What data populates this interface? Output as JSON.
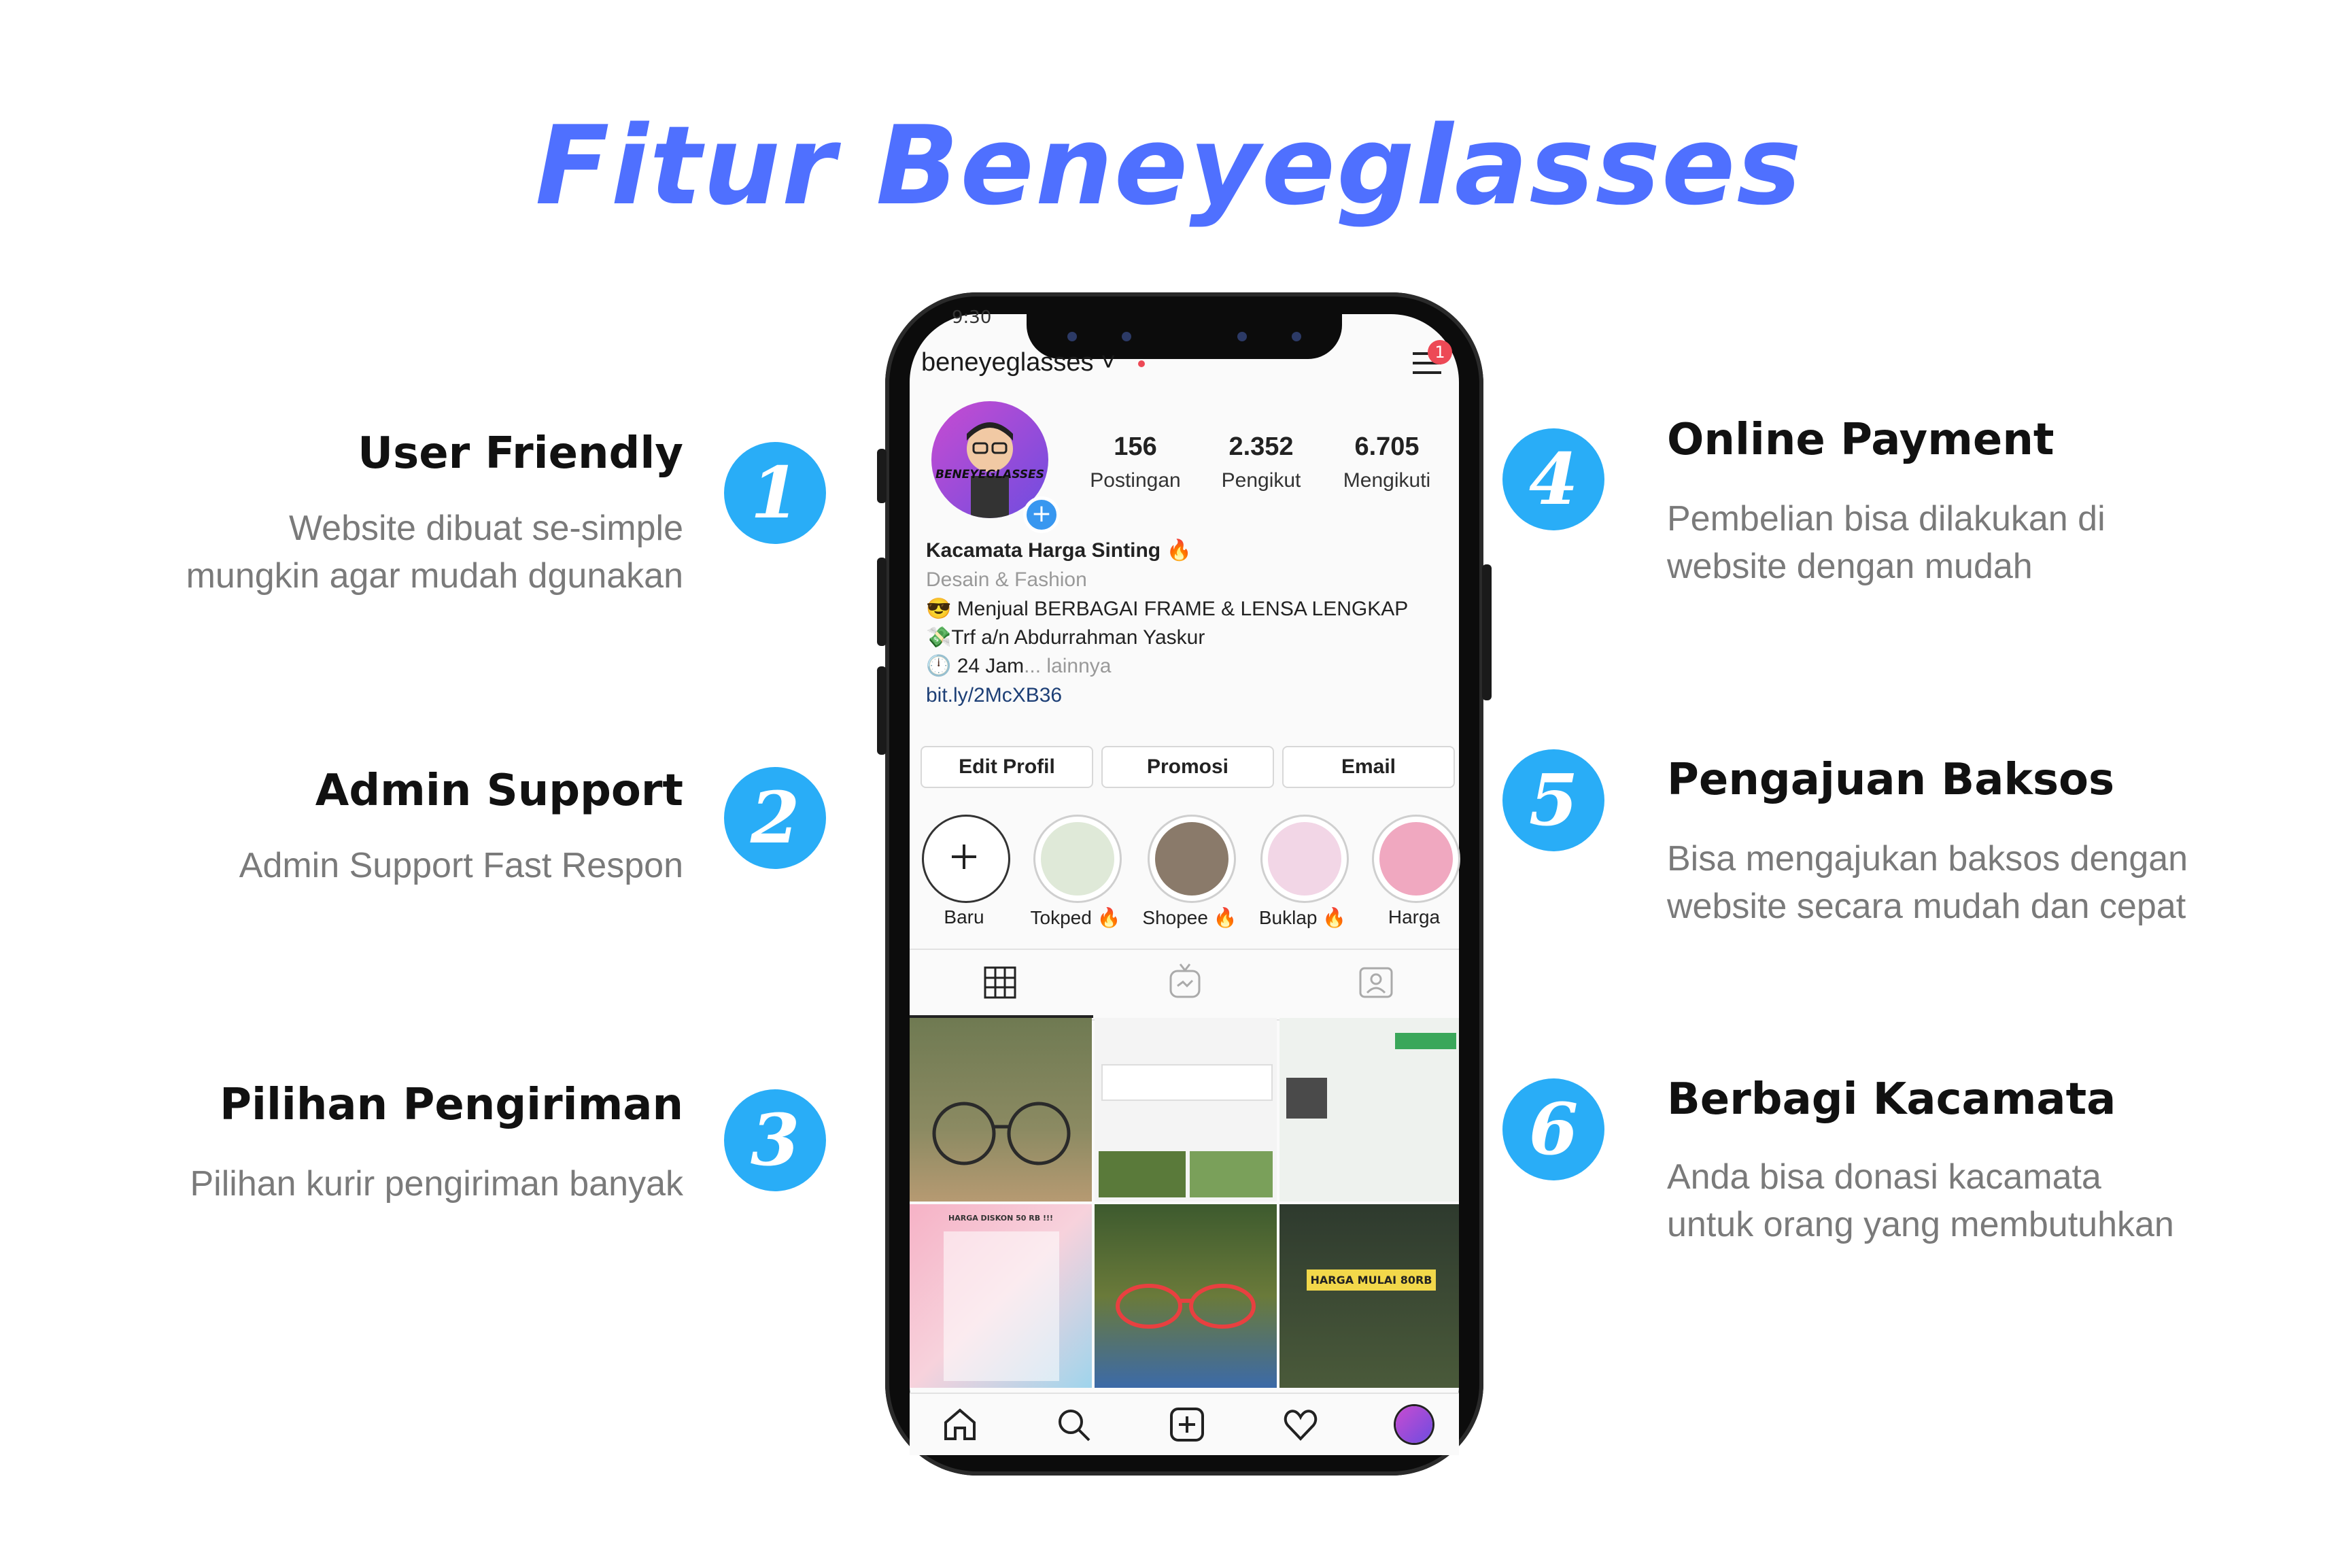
{
  "title": "Fitur Beneyeglasses",
  "features_left": [
    {
      "number": "1",
      "title": "User Friendly",
      "desc_line1": "Website dibuat se-simple",
      "desc_line2": "mungkin agar mudah dgunakan"
    },
    {
      "number": "2",
      "title": "Admin Support",
      "desc_line1": "Admin Support Fast Respon"
    },
    {
      "number": "3",
      "title": "Pilihan Pengiriman",
      "desc_line1": "Pilihan kurir pengiriman banyak"
    }
  ],
  "features_right": [
    {
      "number": "4",
      "title": "Online Payment",
      "desc_line1": "Pembelian bisa dilakukan di",
      "desc_line2": "website dengan mudah"
    },
    {
      "number": "5",
      "title": "Pengajuan Baksos",
      "desc_line1": "Bisa mengajukan baksos dengan",
      "desc_line2": "website secara mudah dan cepat"
    },
    {
      "number": "6",
      "title": "Berbagi Kacamata",
      "desc_line1": "Anda bisa donasi kacamata",
      "desc_line2": "untuk orang yang membutuhkan"
    }
  ],
  "phone": {
    "username": "beneyeglasses ˅",
    "notification_count": "1",
    "avatar_text": "BENEYEGLASSES",
    "stats": [
      {
        "value": "156",
        "label": "Postingan"
      },
      {
        "value": "2.352",
        "label": "Pengikut"
      },
      {
        "value": "6.705",
        "label": "Mengikuti"
      }
    ],
    "bio": {
      "name": "Kacamata Harga Sinting 🔥",
      "category": "Desain & Fashion",
      "line1": "😎 Menjual BERBAGAI FRAME & LENSA LENGKAP",
      "line2": "💸Trf a/n Abdurrahman Yaskur",
      "line3_main": "🕛 24 Jam",
      "line3_more": "... lainnya",
      "link": "bit.ly/2McXB36"
    },
    "buttons": [
      "Edit Profil",
      "Promosi",
      "Email"
    ],
    "highlights": [
      {
        "label": "Baru",
        "color": "#ffffff"
      },
      {
        "label": "Tokped 🔥",
        "color": "#dfe9d8"
      },
      {
        "label": "Shopee 🔥",
        "color": "#8a7a6a"
      },
      {
        "label": "Buklap 🔥",
        "color": "#f2d6e6"
      },
      {
        "label": "Harga",
        "color": "#f0a8c0"
      }
    ],
    "grid_colors": [
      "#7a7f5a",
      "#f4f4f4",
      "#eef2ee",
      "#f4b8c8",
      "#4a6a3a",
      "#3c4a3a"
    ],
    "grid_texts": {
      "cell4_title": "HARGA DISKON 50 RB !!!",
      "cell6_title": "HARGA MULAI 80RB"
    },
    "icons": {
      "status": "9:30",
      "tabs": [
        "grid-icon",
        "igtv-icon",
        "tagged-icon"
      ],
      "nav": [
        "home-icon",
        "search-icon",
        "add-icon",
        "heart-icon",
        "profile-icon"
      ]
    }
  },
  "colors": {
    "title": "#4f70ff",
    "badge": "#29adf7",
    "feature_title": "#111111",
    "feature_desc": "#7a7a7a"
  }
}
